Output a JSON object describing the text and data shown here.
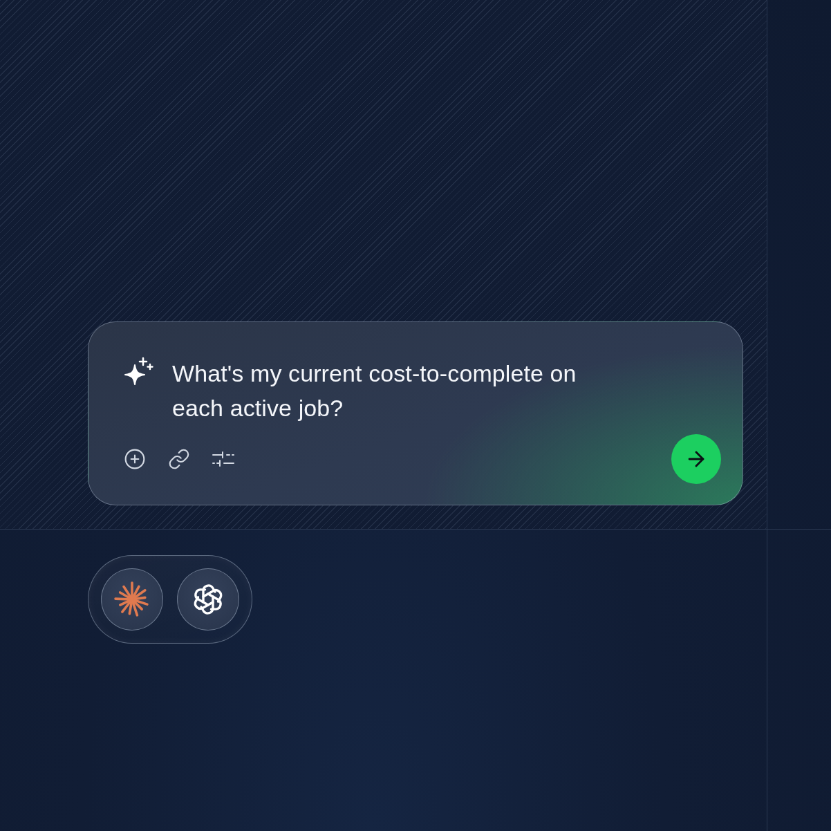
{
  "prompt_card": {
    "value": "What's my current cost-to-complete on each active job?"
  }
}
